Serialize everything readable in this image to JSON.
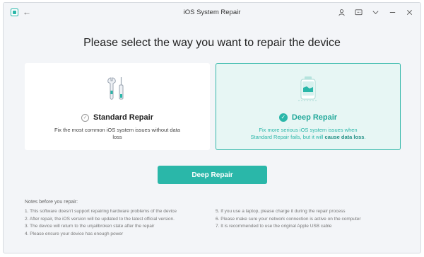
{
  "window": {
    "title": "iOS System Repair"
  },
  "titlebar": {
    "icons": [
      "app-logo-icon",
      "back-arrow-icon",
      "account-icon",
      "feedback-icon",
      "menu-chevron-icon",
      "minimize-icon",
      "close-icon"
    ]
  },
  "main": {
    "heading": "Please select the way you want to repair the device",
    "standard": {
      "name": "Standard Repair",
      "description": "Fix the most common iOS system issues without data loss",
      "icon": "tools-icon"
    },
    "deep": {
      "name": "Deep Repair",
      "description_prefix": "Fix more serious iOS system issues when Standard Repair fails, but it will ",
      "description_bold": "cause data loss",
      "description_suffix": ".",
      "icon": "device-repair-icon"
    },
    "primary_button": "Deep Repair"
  },
  "notes": {
    "title": "Notes before you repair:",
    "left": [
      "1. This software doesn't support repairing hardware problems of the device",
      "2. After repair, the iOS version will be updated to the latest official version.",
      "3. The device will return to the unjailbroken state after the repair",
      "4. Please ensure your device has enough power"
    ],
    "right": [
      "5. If you use a laptop, please charge it during the repair process",
      "6. Please make sure your network connection is active on the computer",
      "7. It is recommended to use the original Apple USB cable"
    ]
  },
  "colors": {
    "accent": "#2ab7a9",
    "selected_card_bg": "#e7f6f4",
    "window_bg": "#f3f5f8"
  }
}
